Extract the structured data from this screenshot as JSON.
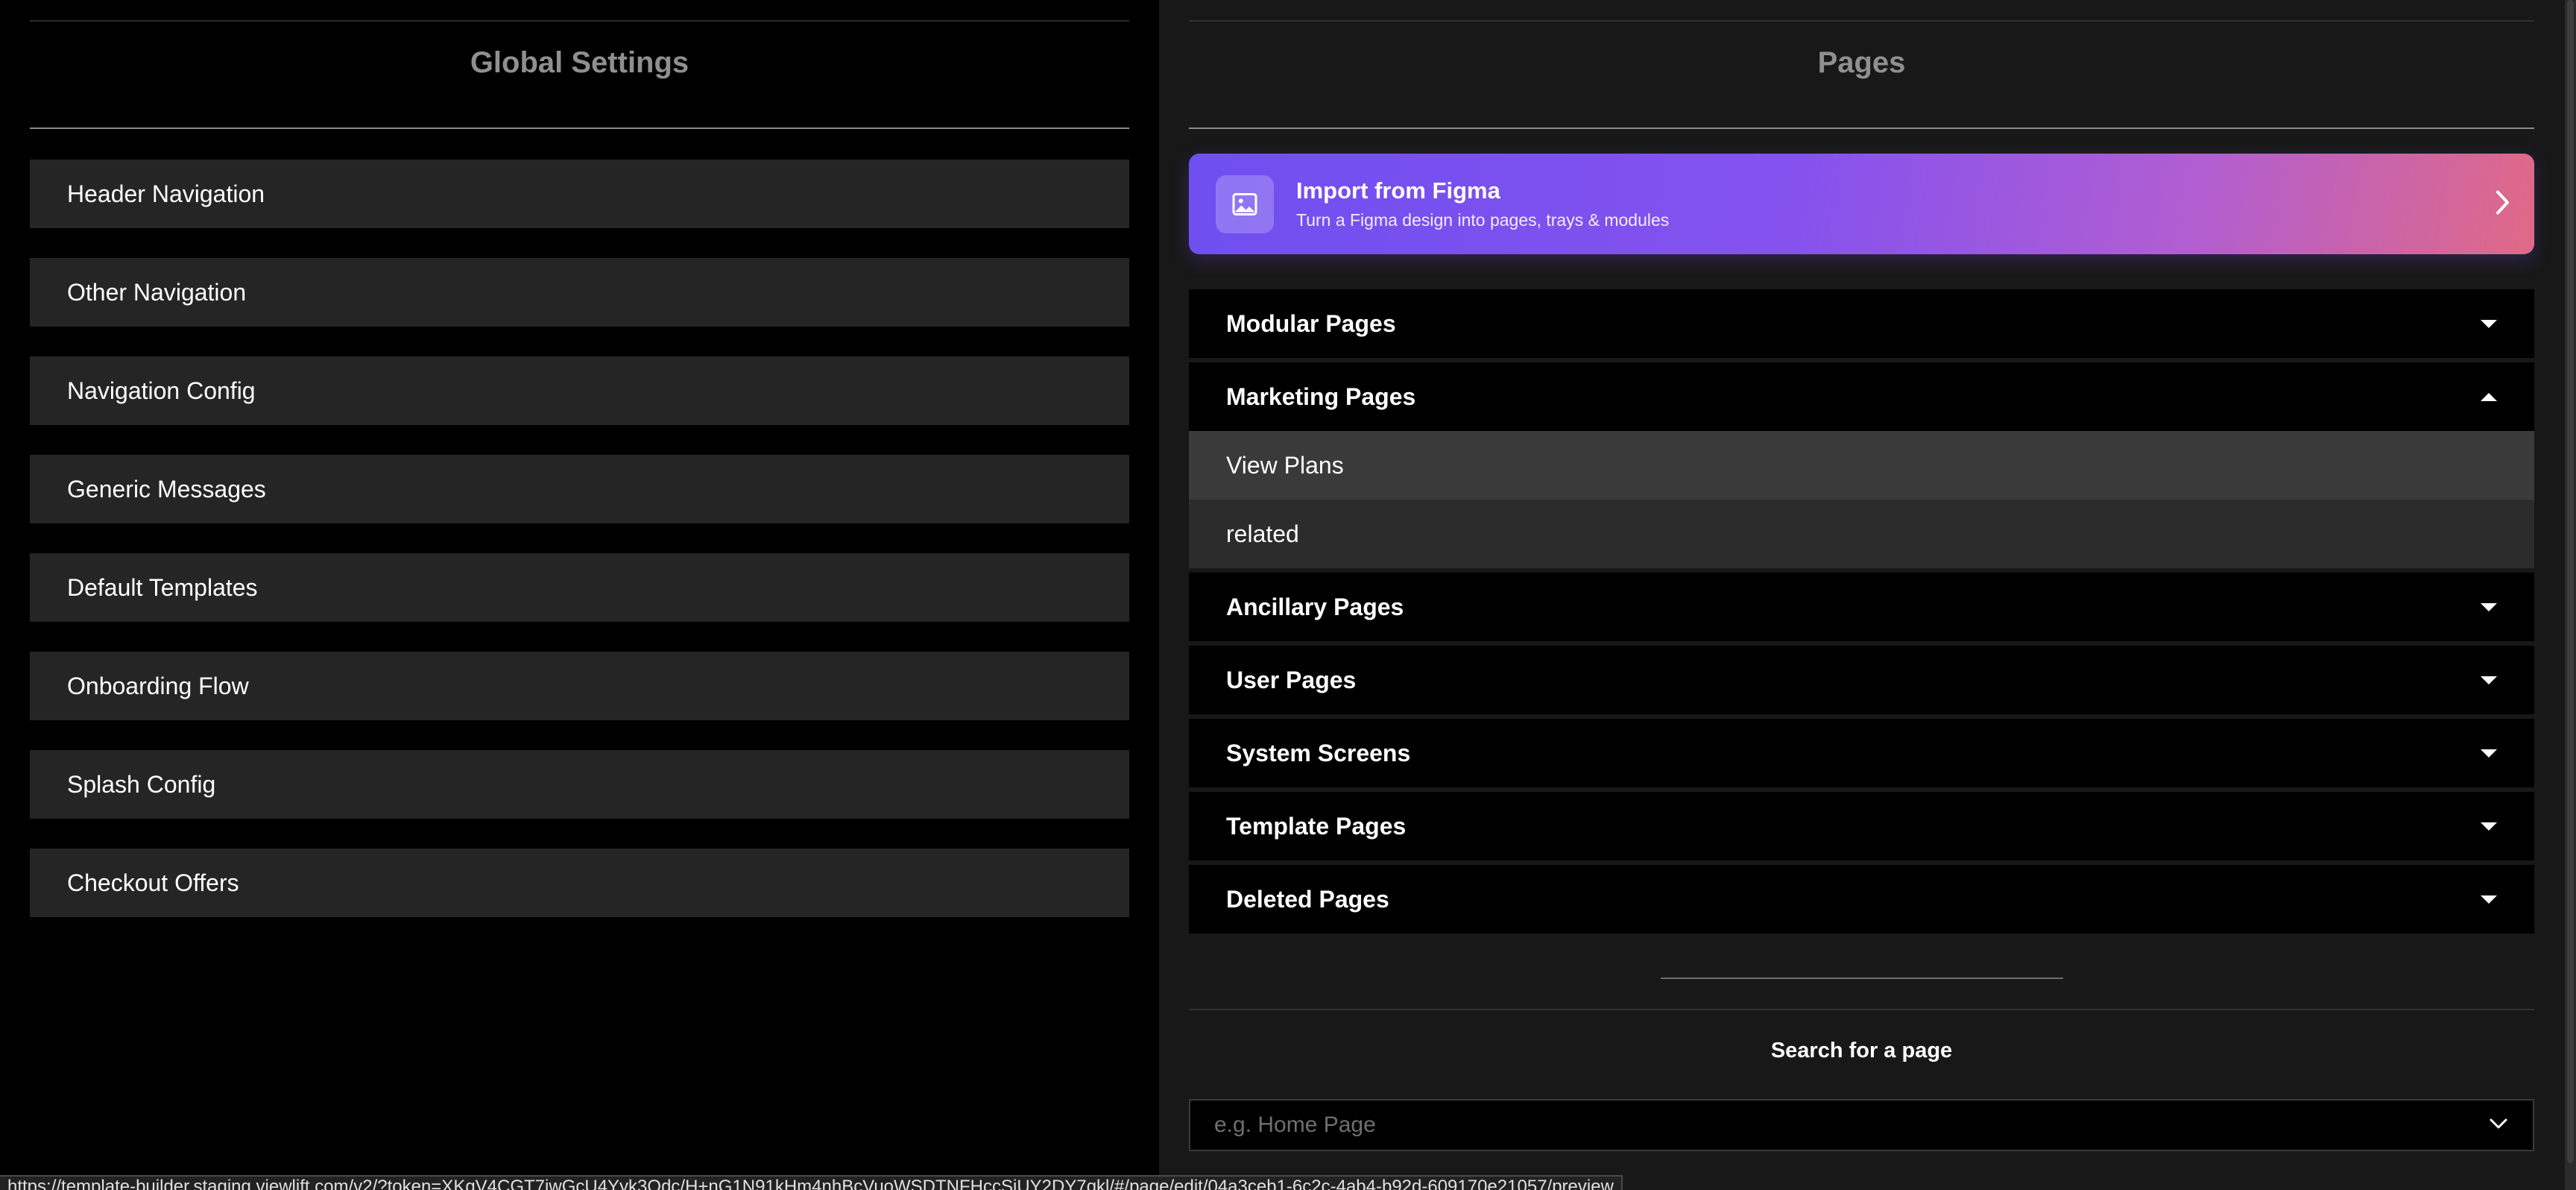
{
  "global_settings": {
    "title": "Global Settings",
    "items": [
      {
        "label": "Header Navigation"
      },
      {
        "label": "Other Navigation"
      },
      {
        "label": "Navigation Config"
      },
      {
        "label": "Generic Messages"
      },
      {
        "label": "Default Templates"
      },
      {
        "label": "Onboarding Flow"
      },
      {
        "label": "Splash Config"
      },
      {
        "label": "Checkout Offers"
      }
    ]
  },
  "pages": {
    "title": "Pages",
    "figma_banner": {
      "title": "Import from Figma",
      "subtitle": "Turn a Figma design into pages, trays & modules",
      "icon": "image-icon",
      "colors": [
        "#6f4ff0",
        "#e06a86"
      ]
    },
    "sections": {
      "modular": {
        "label": "Modular Pages",
        "expanded": false
      },
      "marketing": {
        "label": "Marketing Pages",
        "expanded": true,
        "items": [
          {
            "label": "View Plans",
            "active": true
          },
          {
            "label": "related",
            "active": false
          }
        ]
      },
      "ancillary": {
        "label": "Ancillary Pages",
        "expanded": false
      },
      "user": {
        "label": "User Pages",
        "expanded": false
      },
      "system": {
        "label": "System Screens",
        "expanded": false
      },
      "template": {
        "label": "Template Pages",
        "expanded": false
      },
      "deleted": {
        "label": "Deleted Pages",
        "expanded": false
      }
    },
    "search": {
      "label": "Search for a page",
      "placeholder": "e.g. Home Page"
    }
  },
  "status_bar": {
    "url": "https://template-builder.staging.viewlift.com/v2/?token=XKgV4CGT7iwGcU4Yyk3Odc/H+nG1N91kHm4nhBcVuoWSDTNFHccSjUY2DY7qkl/#/page/edit/04a3ceb1-6c2c-4ab4-b92d-609170e21057/preview"
  }
}
